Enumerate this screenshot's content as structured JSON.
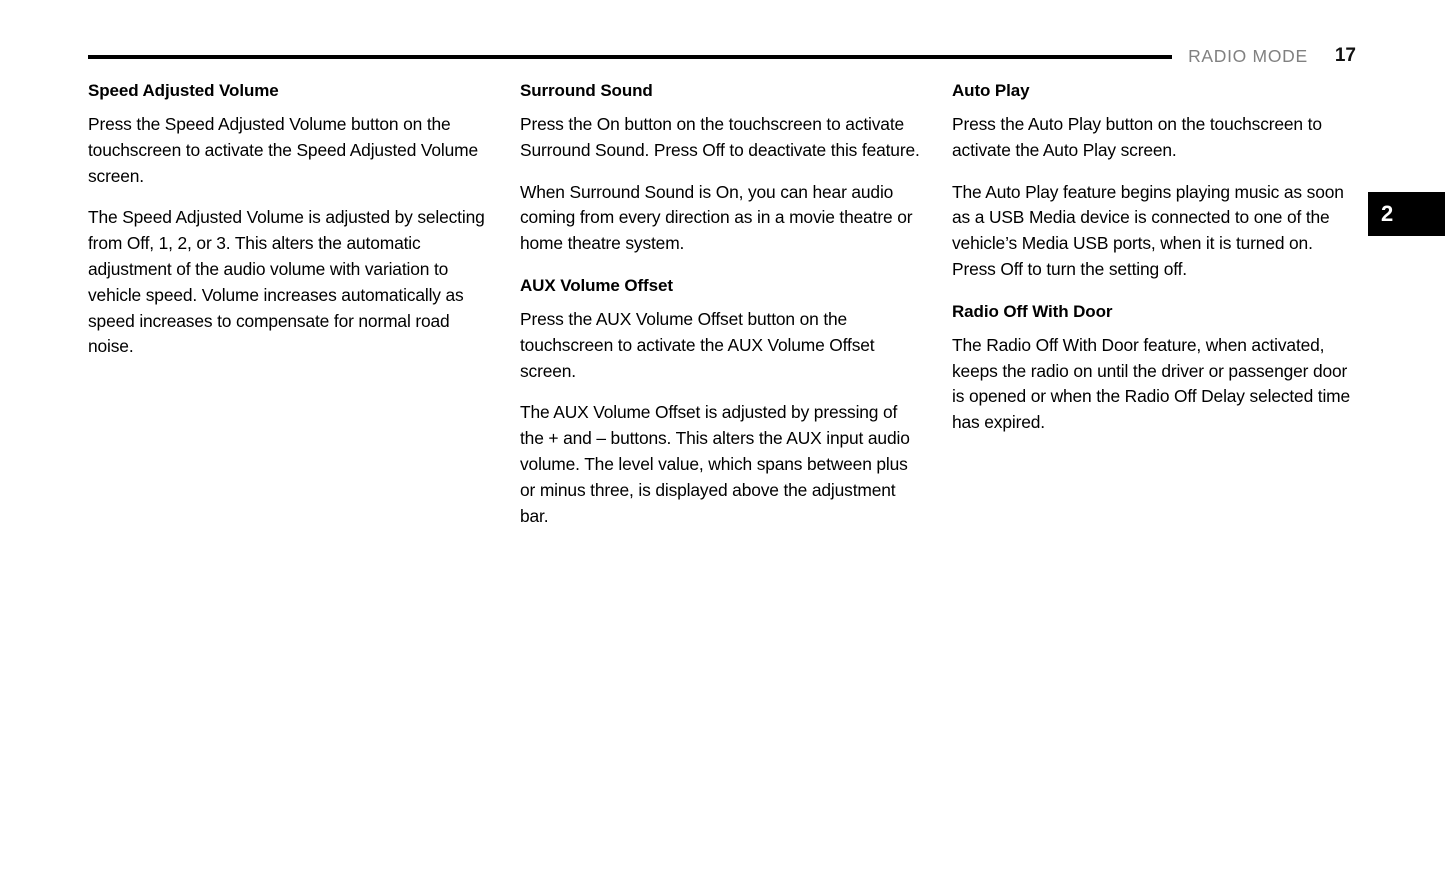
{
  "header": {
    "title": "RADIO MODE",
    "page_number": "17"
  },
  "chapter_tab": {
    "number": "2",
    "background_color": "#000000",
    "text_color": "#ffffff"
  },
  "colors": {
    "header_title": "#808080",
    "rule": "#000000",
    "body_text": "#000000"
  },
  "columns": [
    {
      "id": "column-1",
      "blocks": [
        {
          "type": "heading",
          "text": "Speed Adjusted Volume"
        },
        {
          "type": "paragraph",
          "text": "Press the Speed Adjusted Volume button on the touchscreen to activate the Speed Adjusted Volume screen."
        },
        {
          "type": "paragraph",
          "text": "The Speed Adjusted Volume is adjusted by selecting from Off, 1, 2, or 3. This alters the automatic adjustment of the audio volume with variation to vehicle speed. Volume increases automatically as speed increases to compensate for normal road noise."
        }
      ]
    },
    {
      "id": "column-2",
      "blocks": [
        {
          "type": "heading",
          "text": "Surround Sound"
        },
        {
          "type": "paragraph",
          "text": "Press the On button on the touchscreen to activate Surround Sound. Press Off to deactivate this feature."
        },
        {
          "type": "paragraph",
          "text": "When Surround Sound is On, you can hear audio coming from every direction as in a movie theatre or home theatre system."
        },
        {
          "type": "heading",
          "text": "AUX Volume Offset"
        },
        {
          "type": "paragraph",
          "text": "Press the AUX Volume Offset button on the touchscreen to activate the AUX Volume Offset screen."
        },
        {
          "type": "paragraph",
          "text": "The AUX Volume Offset is adjusted by pressing of the + and – buttons. This alters the AUX input audio volume. The level value, which spans between plus or minus three, is displayed above the adjustment bar."
        }
      ]
    },
    {
      "id": "column-3",
      "blocks": [
        {
          "type": "heading",
          "text": "Auto Play"
        },
        {
          "type": "paragraph",
          "text": "Press the Auto Play button on the touchscreen to activate the Auto Play screen."
        },
        {
          "type": "paragraph",
          "text": "The Auto Play feature begins playing music as soon as a USB Media device is connected to one of the vehicle’s Media USB ports, when it is turned on. Press Off to turn the setting off."
        },
        {
          "type": "heading",
          "text": "Radio Off With Door"
        },
        {
          "type": "paragraph",
          "text": "The Radio Off With Door feature, when activated, keeps the radio on until the driver or passenger door is opened or when the Radio Off Delay selected time has expired."
        }
      ]
    }
  ]
}
